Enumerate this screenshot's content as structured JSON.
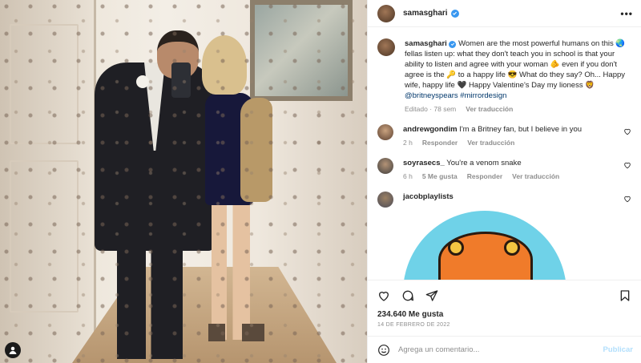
{
  "post": {
    "author": "samasghari",
    "more_label": "•••"
  },
  "caption": {
    "author": "samasghari",
    "text": " Women are the most powerful humans on this 🌏 fellas listen up: what they don't teach you in school is that your ability to listen and agree with your woman 🫵 even if you don't agree is the 🔑 to a happy life 😎 What do they say? Oh... Happy wife, happy life 🖤 Happy Valentine's Day my lioness 🦁 ",
    "mentions": "@britneyspears #mirrordesign",
    "edited": "Editado · 78 sem",
    "see_translation": "Ver traducción"
  },
  "comments": [
    {
      "user": "andrewgondim",
      "text": " I'm a Britney fan, but I believe in you",
      "time": "2 h",
      "reply": "Responder",
      "translate": "Ver traducción"
    },
    {
      "user": "soyrasecs_",
      "text": " You're a venom snake",
      "time": "6 h",
      "likes": "5 Me gusta",
      "reply": "Responder",
      "translate": "Ver traducción"
    },
    {
      "user": "jacobplaylists",
      "text": ""
    }
  ],
  "stats": {
    "likes": "234.640 Me gusta",
    "date": "14 DE FEBRERO DE 2022"
  },
  "composer": {
    "placeholder": "Agrega un comentario...",
    "publish": "Publicar"
  },
  "colors": {
    "verified": "#3897f0",
    "link": "#00376b",
    "muted": "#8e8e8e",
    "publish": "#b2dffc"
  }
}
